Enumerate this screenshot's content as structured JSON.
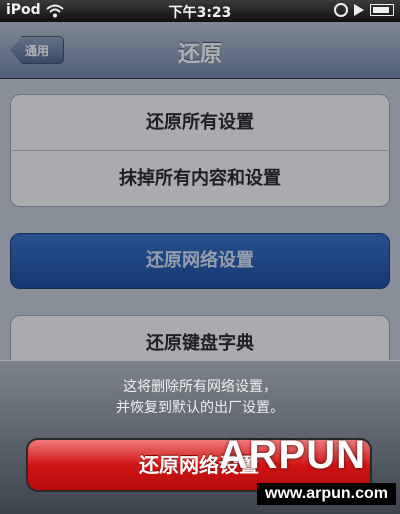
{
  "status_bar": {
    "carrier": "iPod",
    "time": "下午3:23"
  },
  "nav": {
    "back_label": "通用",
    "title": "还原"
  },
  "reset_group_1": {
    "items": [
      "还原所有设置",
      "抹掉所有内容和设置"
    ]
  },
  "selected_item": {
    "label": "还原网络设置"
  },
  "reset_group_2": {
    "items": [
      "还原键盘字典"
    ]
  },
  "action_sheet": {
    "message_line1": "这将删除所有网络设置，",
    "message_line2": "并恢复到默认的出厂设置。",
    "confirm_label": "还原网络设置"
  },
  "watermark": {
    "logo": "ARPUN",
    "url": "www.arpun.com"
  },
  "colors": {
    "selected_blue": "#1f5bb5",
    "destructive_red": "#d11515"
  }
}
